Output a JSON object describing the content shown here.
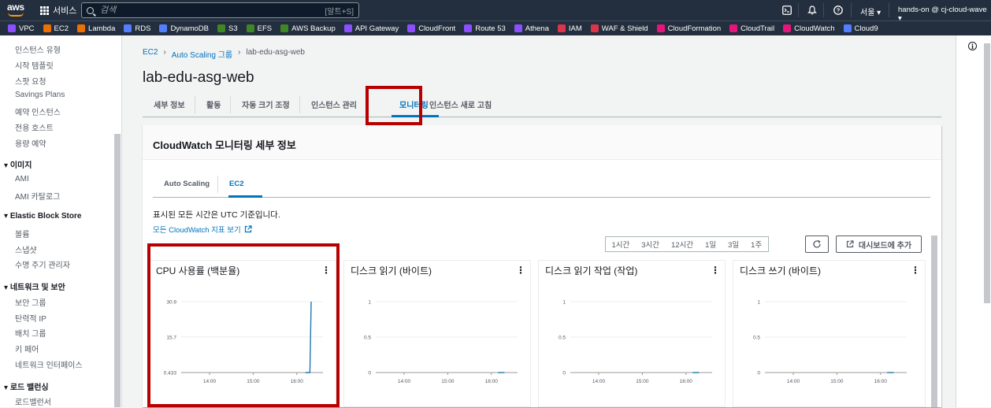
{
  "topbar": {
    "logo": "aws",
    "services_label": "서비스",
    "search_placeholder": "검색",
    "search_shortcut": "[알트+S]",
    "region": "서울 ▾",
    "account": "hands-on @ cj-cloud-wave ▾",
    "icons": [
      "cloudshell-icon",
      "bell-icon",
      "help-icon",
      "settings-icon"
    ]
  },
  "favorites": [
    {
      "label": "VPC",
      "color": "#8c4fff"
    },
    {
      "label": "EC2",
      "color": "#ed7100"
    },
    {
      "label": "Lambda",
      "color": "#ed7100"
    },
    {
      "label": "RDS",
      "color": "#527fff"
    },
    {
      "label": "DynamoDB",
      "color": "#527fff"
    },
    {
      "label": "S3",
      "color": "#3f8624"
    },
    {
      "label": "EFS",
      "color": "#3f8624"
    },
    {
      "label": "AWS Backup",
      "color": "#3f8624"
    },
    {
      "label": "API Gateway",
      "color": "#8c4fff"
    },
    {
      "label": "CloudFront",
      "color": "#8c4fff"
    },
    {
      "label": "Route 53",
      "color": "#8c4fff"
    },
    {
      "label": "Athena",
      "color": "#8c4fff"
    },
    {
      "label": "IAM",
      "color": "#dd344c"
    },
    {
      "label": "WAF & Shield",
      "color": "#dd344c"
    },
    {
      "label": "CloudFormation",
      "color": "#e7157b"
    },
    {
      "label": "CloudTrail",
      "color": "#e7157b"
    },
    {
      "label": "CloudWatch",
      "color": "#e7157b"
    },
    {
      "label": "Cloud9",
      "color": "#527fff"
    }
  ],
  "sidebar": {
    "instances": [
      "인스턴스 유형",
      "시작 템플릿",
      "스팟 요청",
      "Savings Plans",
      "예약 인스턴스",
      "전용 호스트",
      "용량 예약"
    ],
    "images_head": "이미지",
    "images": [
      "AMI",
      "AMI 카탈로그"
    ],
    "ebs_head": "Elastic Block Store",
    "ebs": [
      "볼륨",
      "스냅샷",
      "수명 주기 관리자"
    ],
    "net_head": "네트워크 및 보안",
    "net": [
      "보안 그룹",
      "탄력적 IP",
      "배치 그룹",
      "키 페어",
      "네트워크 인터페이스"
    ],
    "lb_head": "로드 밸런싱",
    "lb": [
      "로드밸런서"
    ]
  },
  "breadcrumb": {
    "ec2": "EC2",
    "asg": "Auto Scaling 그룹",
    "current": "lab-edu-asg-web"
  },
  "page_title": "lab-edu-asg-web",
  "tabs": [
    "세부 정보",
    "활동",
    "자동 크기 조정",
    "인스턴스 관리",
    "모니터링",
    "인스턴스 새로 고침"
  ],
  "active_tab": "모니터링",
  "card": {
    "title": "CloudWatch 모니터링 세부 정보",
    "subtabs": [
      "Auto Scaling",
      "EC2"
    ],
    "active_subtab": "EC2",
    "utc_note": "표시된 모든 시간은 UTC 기준입니다.",
    "cw_link": "모든 CloudWatch 지표 보기",
    "time_ranges": [
      "1시간",
      "3시간",
      "12시간",
      "1일",
      "3일",
      "1주"
    ],
    "add_dashboard": "대시보드에 추가"
  },
  "chart_data": [
    {
      "type": "line",
      "title": "CPU 사용률 (백분율)",
      "x": [
        "14:00",
        "15:00",
        "16:00"
      ],
      "yticks": [
        "30.9",
        "15.7",
        "0.433"
      ],
      "ylim": [
        0.433,
        30.9
      ],
      "series": [
        {
          "values": [
            [
              16.2,
              0.433
            ],
            [
              16.3,
              0.433
            ],
            [
              16.33,
              30.9
            ]
          ]
        }
      ],
      "color": "#1f77b4"
    },
    {
      "type": "line",
      "title": "디스크 읽기 (바이트)",
      "x": [
        "14:00",
        "15:00",
        "16:00"
      ],
      "yticks": [
        "1",
        "0.5",
        "0"
      ],
      "ylim": [
        0,
        1
      ],
      "series": [
        {
          "values": [
            [
              16.15,
              0
            ],
            [
              16.3,
              0
            ]
          ]
        }
      ],
      "color": "#1f77b4"
    },
    {
      "type": "line",
      "title": "디스크 읽기 작업 (작업)",
      "x": [
        "14:00",
        "15:00",
        "16:00"
      ],
      "yticks": [
        "1",
        "0.5",
        "0"
      ],
      "ylim": [
        0,
        1
      ],
      "series": [
        {
          "values": [
            [
              16.15,
              0
            ],
            [
              16.3,
              0
            ]
          ]
        }
      ],
      "color": "#1f77b4"
    },
    {
      "type": "line",
      "title": "디스크 쓰기 (바이트)",
      "x": [
        "14:00",
        "15:00",
        "16:00"
      ],
      "yticks": [
        "1",
        "0.5",
        "0"
      ],
      "ylim": [
        0,
        1
      ],
      "series": [
        {
          "values": [
            [
              16.15,
              0
            ],
            [
              16.3,
              0
            ]
          ]
        }
      ],
      "color": "#1f77b4"
    }
  ]
}
